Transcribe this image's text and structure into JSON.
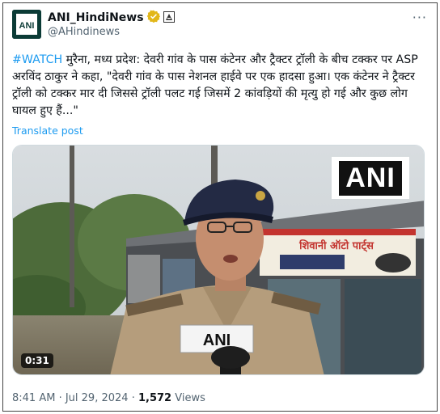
{
  "author": {
    "display_name": "ANI_HindiNews",
    "handle": "@AHindinews",
    "avatar_text": "ANI"
  },
  "tweet": {
    "hashtag": "#WATCH",
    "body": " मुरैना, मध्य प्रदेश: देवरी गांव के पास कंटेनर और ट्रैक्टर ट्रॉली के बीच टक्कर पर ASP अरविंद ठाकुर ने कहा, \"देवरी गांव के पास नेशनल हाईवे पर एक हादसा हुआ। एक कंटेनर ने ट्रैक्टर ट्रॉली को टक्कर मार दी जिससे ट्रॉली पलट गई जिसमें 2 कांवड़ियों की मृत्यु हो गई और कुछ लोग घायल हुए हैं...\"",
    "translate_label": "Translate post"
  },
  "media": {
    "duration": "0:31",
    "watermark": "ANI",
    "mic_label": "ANI",
    "shop_sign": "शिवानी ऑटो पार्ट्स"
  },
  "meta": {
    "time": "8:41 AM",
    "date": "Jul 29, 2024",
    "separator": " · ",
    "views_count": "1,572",
    "views_label": " Views"
  }
}
